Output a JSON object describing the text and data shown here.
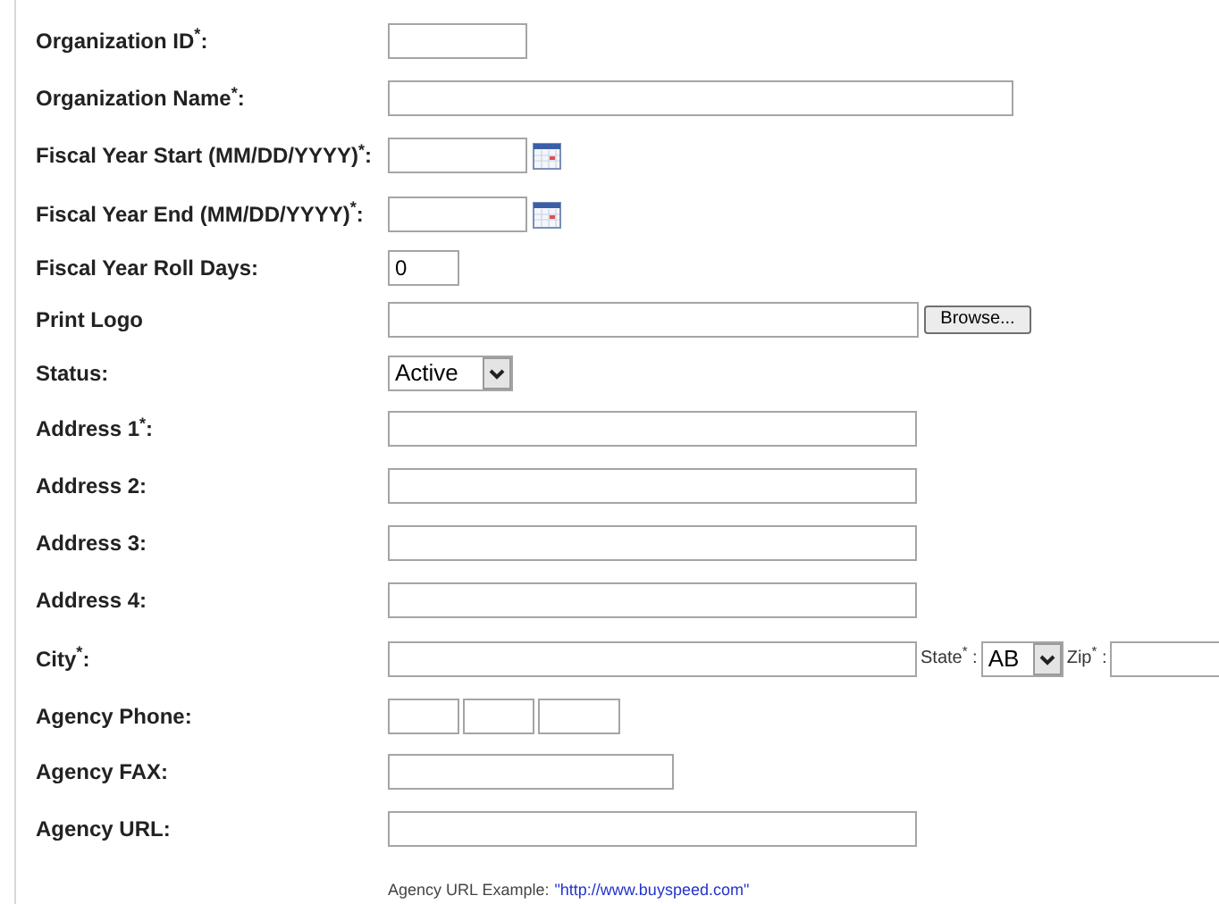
{
  "fields": [
    {
      "kind": "text",
      "label": "Organization ID$^{*}$:"
    },
    {
      "kind": "text",
      "label": "Organization Name$^{*}$:"
    },
    {
      "kind": "date",
      "label": "Fiscal Year Start (MM/DD/YYYY)$^{*}$:"
    },
    {
      "kind": "date",
      "label": "Fiscal Year End (MM/DD/YYYY)$^{*}$:"
    },
    {
      "kind": "text",
      "label": "Fiscal Year Roll Days:",
      "value": "0"
    },
    {
      "kind": "file",
      "label": "Print Logo",
      "button": "Browse..."
    },
    {
      "kind": "select",
      "label": "Status:",
      "value": "Active"
    },
    {
      "kind": "text",
      "label": "Address 1$^{*}$:"
    },
    {
      "kind": "text",
      "label": "Address 2:"
    },
    {
      "kind": "text",
      "label": "Address 3:"
    },
    {
      "kind": "text",
      "label": "Address 4:"
    },
    {
      "kind": "city",
      "label": "City$^{*}$:",
      "state_label": "State$^{*}$ :",
      "state_value": "AB",
      "zip_label": "Zip$^{*}$ :"
    },
    {
      "kind": "phone",
      "label": "Agency Phone:"
    },
    {
      "kind": "text",
      "label": "Agency FAX:"
    },
    {
      "kind": "text",
      "label": "Agency URL:"
    }
  ],
  "url_example": {
    "label": "Agency URL Example:",
    "value": "\"http://www.buyspeed.com\""
  }
}
